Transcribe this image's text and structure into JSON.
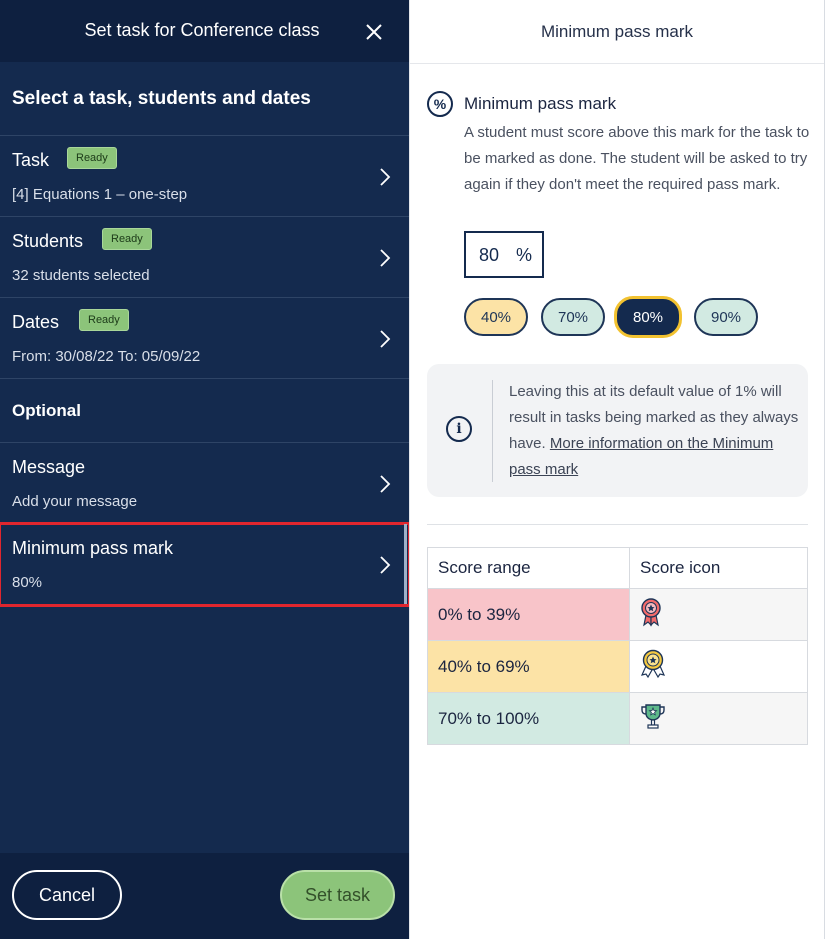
{
  "left": {
    "header_title": "Set task for Conference class",
    "section_title": "Select a task, students and dates",
    "rows": [
      {
        "label": "Task",
        "badge": "Ready",
        "sub": "[4] Equations 1 – one-step"
      },
      {
        "label": "Students",
        "badge": "Ready",
        "sub": "32 students selected"
      },
      {
        "label": "Dates",
        "badge": "Ready",
        "sub": "From: 30/08/22 To: 05/09/22"
      }
    ],
    "optional_title": "Optional",
    "optional_rows": [
      {
        "label": "Message",
        "sub": "Add your message"
      },
      {
        "label": "Minimum pass mark",
        "sub": "80%"
      }
    ],
    "cancel_label": "Cancel",
    "set_label": "Set task"
  },
  "right": {
    "header_title": "Minimum pass mark",
    "pm_icon": "%",
    "pm_title": "Minimum pass mark",
    "pm_desc": "A student must score above this mark for the task to be marked as done. The student will be asked to try again if they don't meet the required pass mark.",
    "input_value": "80",
    "input_unit": "%",
    "chips": [
      "40%",
      "70%",
      "80%",
      "90%"
    ],
    "info_icon": "i",
    "info_text": "Leaving this at its default value of 1% will result in tasks being marked as they always have. ",
    "info_link": "More information on the Minimum pass mark",
    "table": {
      "headers": [
        "Score range",
        "Score icon"
      ],
      "rows": [
        "0% to 39%",
        "40% to 69%",
        "70% to 100%"
      ]
    }
  },
  "colors": {
    "panel_navy": "#142a4e",
    "ready_green": "#8cc47a",
    "selected_outline": "#e0262e",
    "chip_gold": "#f2c230"
  }
}
